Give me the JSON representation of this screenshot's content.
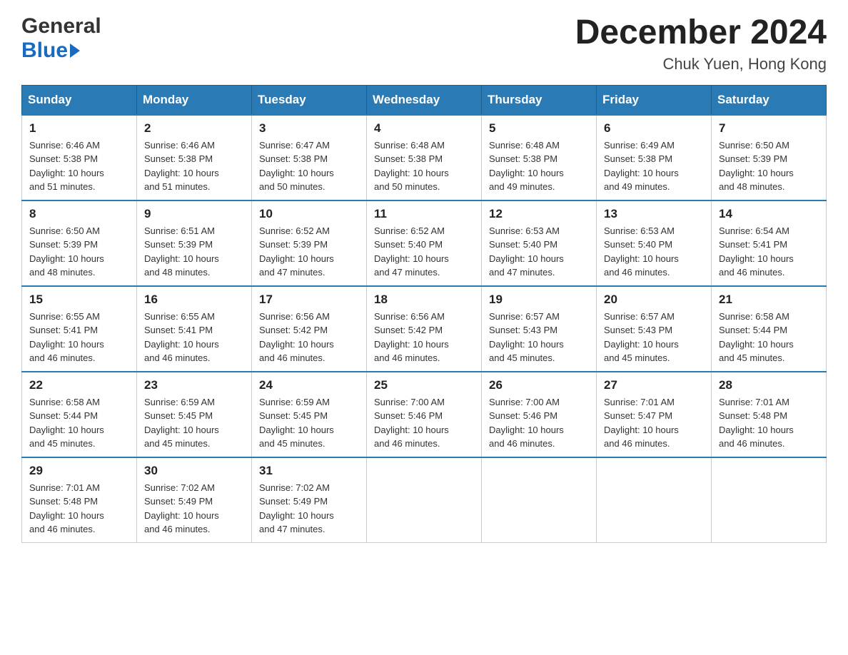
{
  "logo": {
    "general": "General",
    "blue": "Blue"
  },
  "title": {
    "month_year": "December 2024",
    "location": "Chuk Yuen, Hong Kong"
  },
  "calendar": {
    "headers": [
      "Sunday",
      "Monday",
      "Tuesday",
      "Wednesday",
      "Thursday",
      "Friday",
      "Saturday"
    ],
    "weeks": [
      [
        {
          "day": "1",
          "sunrise": "6:46 AM",
          "sunset": "5:38 PM",
          "daylight": "10 hours and 51 minutes."
        },
        {
          "day": "2",
          "sunrise": "6:46 AM",
          "sunset": "5:38 PM",
          "daylight": "10 hours and 51 minutes."
        },
        {
          "day": "3",
          "sunrise": "6:47 AM",
          "sunset": "5:38 PM",
          "daylight": "10 hours and 50 minutes."
        },
        {
          "day": "4",
          "sunrise": "6:48 AM",
          "sunset": "5:38 PM",
          "daylight": "10 hours and 50 minutes."
        },
        {
          "day": "5",
          "sunrise": "6:48 AM",
          "sunset": "5:38 PM",
          "daylight": "10 hours and 49 minutes."
        },
        {
          "day": "6",
          "sunrise": "6:49 AM",
          "sunset": "5:38 PM",
          "daylight": "10 hours and 49 minutes."
        },
        {
          "day": "7",
          "sunrise": "6:50 AM",
          "sunset": "5:39 PM",
          "daylight": "10 hours and 48 minutes."
        }
      ],
      [
        {
          "day": "8",
          "sunrise": "6:50 AM",
          "sunset": "5:39 PM",
          "daylight": "10 hours and 48 minutes."
        },
        {
          "day": "9",
          "sunrise": "6:51 AM",
          "sunset": "5:39 PM",
          "daylight": "10 hours and 48 minutes."
        },
        {
          "day": "10",
          "sunrise": "6:52 AM",
          "sunset": "5:39 PM",
          "daylight": "10 hours and 47 minutes."
        },
        {
          "day": "11",
          "sunrise": "6:52 AM",
          "sunset": "5:40 PM",
          "daylight": "10 hours and 47 minutes."
        },
        {
          "day": "12",
          "sunrise": "6:53 AM",
          "sunset": "5:40 PM",
          "daylight": "10 hours and 47 minutes."
        },
        {
          "day": "13",
          "sunrise": "6:53 AM",
          "sunset": "5:40 PM",
          "daylight": "10 hours and 46 minutes."
        },
        {
          "day": "14",
          "sunrise": "6:54 AM",
          "sunset": "5:41 PM",
          "daylight": "10 hours and 46 minutes."
        }
      ],
      [
        {
          "day": "15",
          "sunrise": "6:55 AM",
          "sunset": "5:41 PM",
          "daylight": "10 hours and 46 minutes."
        },
        {
          "day": "16",
          "sunrise": "6:55 AM",
          "sunset": "5:41 PM",
          "daylight": "10 hours and 46 minutes."
        },
        {
          "day": "17",
          "sunrise": "6:56 AM",
          "sunset": "5:42 PM",
          "daylight": "10 hours and 46 minutes."
        },
        {
          "day": "18",
          "sunrise": "6:56 AM",
          "sunset": "5:42 PM",
          "daylight": "10 hours and 46 minutes."
        },
        {
          "day": "19",
          "sunrise": "6:57 AM",
          "sunset": "5:43 PM",
          "daylight": "10 hours and 45 minutes."
        },
        {
          "day": "20",
          "sunrise": "6:57 AM",
          "sunset": "5:43 PM",
          "daylight": "10 hours and 45 minutes."
        },
        {
          "day": "21",
          "sunrise": "6:58 AM",
          "sunset": "5:44 PM",
          "daylight": "10 hours and 45 minutes."
        }
      ],
      [
        {
          "day": "22",
          "sunrise": "6:58 AM",
          "sunset": "5:44 PM",
          "daylight": "10 hours and 45 minutes."
        },
        {
          "day": "23",
          "sunrise": "6:59 AM",
          "sunset": "5:45 PM",
          "daylight": "10 hours and 45 minutes."
        },
        {
          "day": "24",
          "sunrise": "6:59 AM",
          "sunset": "5:45 PM",
          "daylight": "10 hours and 45 minutes."
        },
        {
          "day": "25",
          "sunrise": "7:00 AM",
          "sunset": "5:46 PM",
          "daylight": "10 hours and 46 minutes."
        },
        {
          "day": "26",
          "sunrise": "7:00 AM",
          "sunset": "5:46 PM",
          "daylight": "10 hours and 46 minutes."
        },
        {
          "day": "27",
          "sunrise": "7:01 AM",
          "sunset": "5:47 PM",
          "daylight": "10 hours and 46 minutes."
        },
        {
          "day": "28",
          "sunrise": "7:01 AM",
          "sunset": "5:48 PM",
          "daylight": "10 hours and 46 minutes."
        }
      ],
      [
        {
          "day": "29",
          "sunrise": "7:01 AM",
          "sunset": "5:48 PM",
          "daylight": "10 hours and 46 minutes."
        },
        {
          "day": "30",
          "sunrise": "7:02 AM",
          "sunset": "5:49 PM",
          "daylight": "10 hours and 46 minutes."
        },
        {
          "day": "31",
          "sunrise": "7:02 AM",
          "sunset": "5:49 PM",
          "daylight": "10 hours and 47 minutes."
        },
        null,
        null,
        null,
        null
      ]
    ],
    "labels": {
      "sunrise": "Sunrise: ",
      "sunset": "Sunset: ",
      "daylight": "Daylight: "
    }
  }
}
